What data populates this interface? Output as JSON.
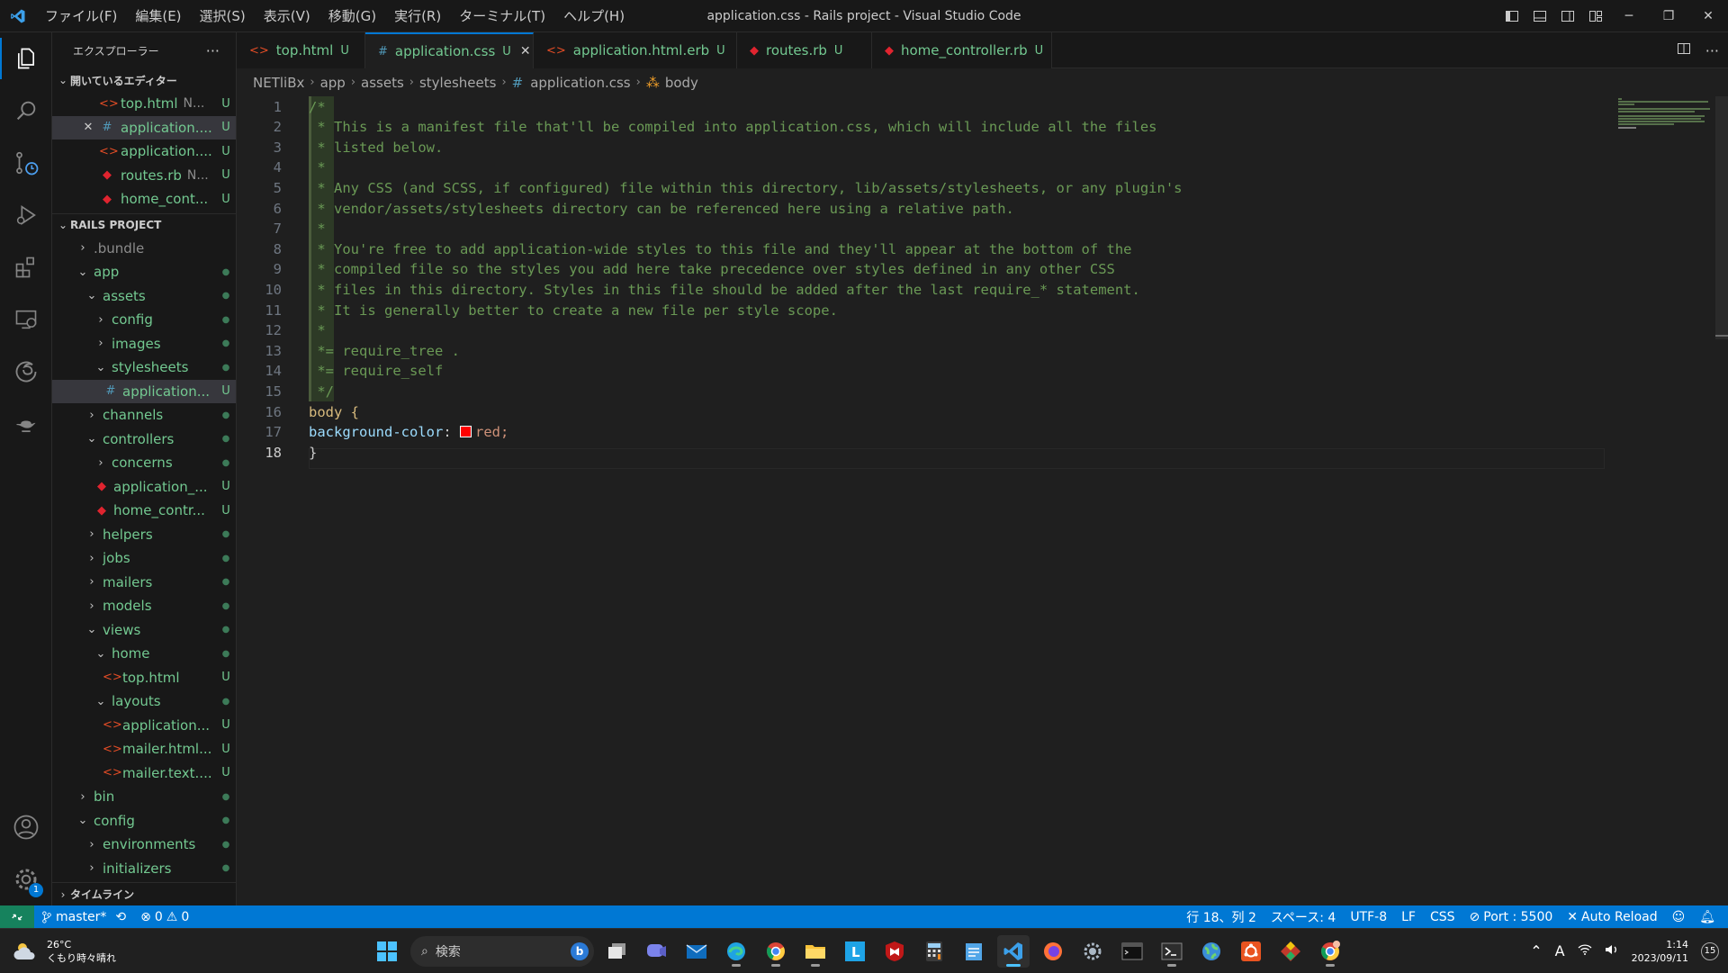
{
  "window": {
    "title": "application.css - Rails project - Visual Studio Code",
    "menu": [
      "ファイル(F)",
      "編集(E)",
      "選択(S)",
      "表示(V)",
      "移動(G)",
      "実行(R)",
      "ターミナル(T)",
      "ヘルプ(H)"
    ]
  },
  "sidebar": {
    "header": "エクスプローラー",
    "open_editors_label": "開いているエディター",
    "open_editors": [
      {
        "name": "top.html",
        "desc": "N...",
        "status": "U",
        "icon": "html-icon"
      },
      {
        "name": "application....",
        "status": "U",
        "icon": "css-icon"
      },
      {
        "name": "application....",
        "status": "U",
        "icon": "html-icon"
      },
      {
        "name": "routes.rb",
        "desc": "N...",
        "status": "U",
        "icon": "ruby-icon"
      },
      {
        "name": "home_cont...",
        "status": "U",
        "icon": "ruby-icon"
      }
    ],
    "project_label": "RAILS PROJECT",
    "tree": [
      {
        "name": ".bundle"
      },
      {
        "name": "app"
      },
      {
        "name": "assets"
      },
      {
        "name": "config"
      },
      {
        "name": "images"
      },
      {
        "name": "stylesheets"
      },
      {
        "name": "application...",
        "status": "U"
      },
      {
        "name": "channels"
      },
      {
        "name": "controllers"
      },
      {
        "name": "concerns"
      },
      {
        "name": "application_...",
        "status": "U"
      },
      {
        "name": "home_contr...",
        "status": "U"
      },
      {
        "name": "helpers"
      },
      {
        "name": "jobs"
      },
      {
        "name": "mailers"
      },
      {
        "name": "models"
      },
      {
        "name": "views"
      },
      {
        "name": "home"
      },
      {
        "name": "top.html",
        "status": "U"
      },
      {
        "name": "layouts"
      },
      {
        "name": "application...",
        "status": "U"
      },
      {
        "name": "mailer.html...",
        "status": "U"
      },
      {
        "name": "mailer.text....",
        "status": "U"
      },
      {
        "name": "bin"
      },
      {
        "name": "config"
      },
      {
        "name": "environments"
      },
      {
        "name": "initializers"
      }
    ],
    "timeline_label": "タイムライン"
  },
  "tabs": [
    {
      "label": "top.html",
      "status": "U"
    },
    {
      "label": "application.css",
      "status": "U"
    },
    {
      "label": "application.html.erb",
      "status": "U"
    },
    {
      "label": "routes.rb",
      "status": "U"
    },
    {
      "label": "home_controller.rb",
      "status": "U"
    }
  ],
  "breadcrumb": [
    "NETliBx",
    "app",
    "assets",
    "stylesheets",
    "application.css",
    "body"
  ],
  "editor": {
    "lines": [
      "/*",
      " * This is a manifest file that'll be compiled into application.css, which will include all the files",
      " * listed below.",
      " *",
      " * Any CSS (and SCSS, if configured) file within this directory, lib/assets/stylesheets, or any plugin's",
      " * vendor/assets/stylesheets directory can be referenced here using a relative path.",
      " *",
      " * You're free to add application-wide styles to this file and they'll appear at the bottom of the",
      " * compiled file so the styles you add here take precedence over styles defined in any other CSS",
      " * files in this directory. Styles in this file should be added after the last require_* statement.",
      " * It is generally better to create a new file per style scope.",
      " *",
      " *= require_tree .",
      " *= require_self",
      " */",
      "body {",
      "background-color: red;",
      "}"
    ],
    "line_numbers": [
      "1",
      "2",
      "3",
      "4",
      "5",
      "6",
      "7",
      "8",
      "9",
      "10",
      "11",
      "12",
      "13",
      "14",
      "15",
      "16",
      "17",
      "18"
    ],
    "prop_name": "background-color",
    "prop_value": "red;",
    "color_swatch": "#ff0000"
  },
  "statusbar": {
    "branch": "master*",
    "errors": "0",
    "warnings": "0",
    "position": "行 18、列 2",
    "spaces": "スペース: 4",
    "encoding": "UTF-8",
    "eol": "LF",
    "language": "CSS",
    "port": "Port : 5500",
    "auto_reload": "Auto Reload"
  },
  "taskbar": {
    "temp": "26°C",
    "weather": "くもり時々晴れ",
    "search_placeholder": "検索",
    "time": "1:14",
    "date": "2023/09/11",
    "notifications": "15",
    "ime": "A"
  },
  "colors": {
    "accent": "#0078d4",
    "status_remote": "#16825d",
    "untracked": "#73c991",
    "comment": "#6a9955"
  }
}
